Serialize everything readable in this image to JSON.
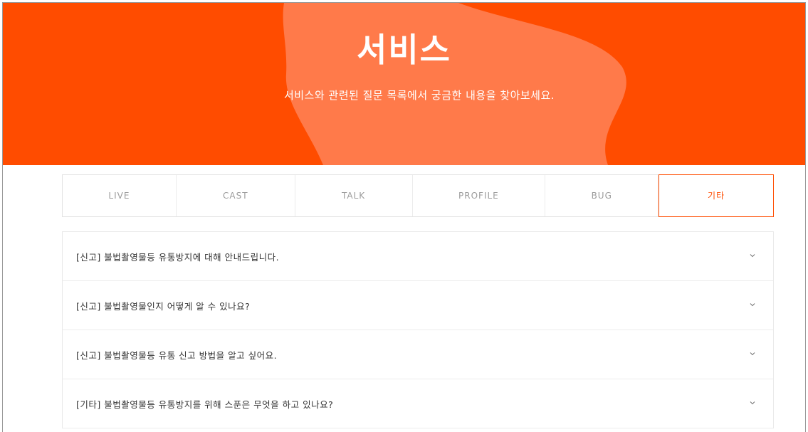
{
  "hero": {
    "title": "서비스",
    "subtitle": "서비스와 관련된 질문 목록에서 궁금한 내용을 찾아보세요."
  },
  "tabs": [
    {
      "label": "LIVE",
      "active": false
    },
    {
      "label": "CAST",
      "active": false
    },
    {
      "label": "TALK",
      "active": false
    },
    {
      "label": "PROFILE",
      "active": false
    },
    {
      "label": "BUG",
      "active": false
    },
    {
      "label": "기타",
      "active": true
    }
  ],
  "faq": [
    {
      "question": "[신고] 불법촬영물등 유통방지에 대해 안내드립니다.",
      "icon": "chevron-down-icon"
    },
    {
      "question": "[신고] 불법촬영물인지 어떻게 알 수 있나요?",
      "icon": "chevron-down-icon"
    },
    {
      "question": "[신고] 불법촬영물등 유통 신고 방법을 알고 싶어요.",
      "icon": "chevron-down-icon"
    },
    {
      "question": "[기타] 불법촬영물등 유통방지를 위해 스푼은 무엇을 하고 있나요?",
      "icon": "chevron-down-icon"
    }
  ],
  "colors": {
    "accent": "#ff4c00",
    "hero_blob": "#ff7a4a",
    "text": "#333333",
    "tab_text": "#9c9c9c"
  }
}
